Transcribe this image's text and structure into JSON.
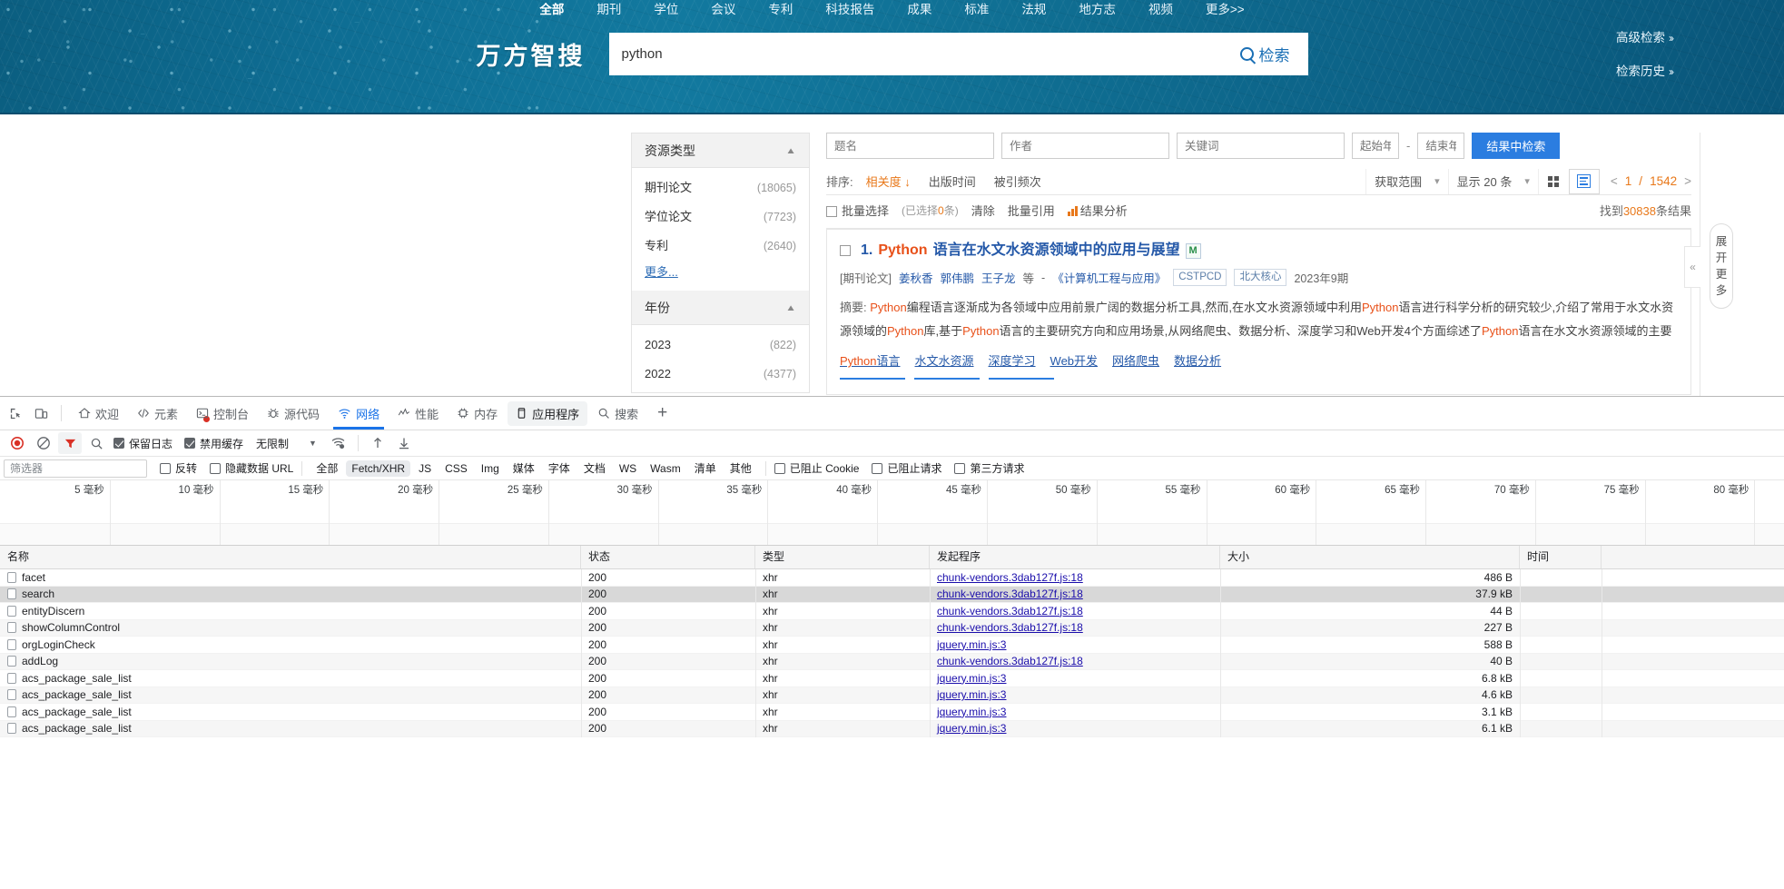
{
  "site": {
    "brand": "万方智搜",
    "topnav": [
      {
        "label": "全部",
        "active": true
      },
      {
        "label": "期刊",
        "active": false
      },
      {
        "label": "学位",
        "active": false
      },
      {
        "label": "会议",
        "active": false
      },
      {
        "label": "专利",
        "active": false
      },
      {
        "label": "科技报告",
        "active": false
      },
      {
        "label": "成果",
        "active": false
      },
      {
        "label": "标准",
        "active": false
      },
      {
        "label": "法规",
        "active": false
      },
      {
        "label": "地方志",
        "active": false
      },
      {
        "label": "视频",
        "active": false
      },
      {
        "label": "更多>>",
        "active": false
      }
    ],
    "search": {
      "value": "python",
      "placeholder": "",
      "button_label": "检索"
    },
    "side_links": [
      {
        "label": "高级检索"
      },
      {
        "label": "检索历史"
      }
    ]
  },
  "facets": [
    {
      "title": "资源类型",
      "items": [
        {
          "label": "期刊论文",
          "count": "(18065)"
        },
        {
          "label": "学位论文",
          "count": "(7723)"
        },
        {
          "label": "专利",
          "count": "(2640)"
        }
      ],
      "more": "更多..."
    },
    {
      "title": "年份",
      "items": [
        {
          "label": "2023",
          "count": "(822)"
        },
        {
          "label": "2022",
          "count": "(4377)"
        }
      ],
      "more": ""
    }
  ],
  "refine": {
    "title_placeholder": "题名",
    "author_placeholder": "作者",
    "keyword_placeholder": "关键词",
    "start_year_placeholder": "起始年",
    "end_year_placeholder": "结束年",
    "dash": "-",
    "button_label": "结果中检索"
  },
  "sortbar": {
    "label": "排序:",
    "options": [
      {
        "label": "相关度",
        "active": true
      },
      {
        "label": "出版时间",
        "active": false
      },
      {
        "label": "被引频次",
        "active": false
      }
    ],
    "scope_label": "获取范围",
    "perpage_label": "显示 20 条",
    "page_current": "1",
    "page_total": "1542",
    "page_sep": "/",
    "prev": "<",
    "next": ">"
  },
  "bulkbar": {
    "select_all": "批量选择",
    "selected_hint_pre": "(已选择",
    "selected_count": "0",
    "selected_hint_post": "条)",
    "clear": "清除",
    "cite": "批量引用",
    "analysis": "结果分析",
    "found_pre": "找到",
    "found_count": "30838",
    "found_post": "条结果"
  },
  "result": {
    "index": "1.",
    "title_hl": "Python",
    "title_rest": "语言在水文水资源领域中的应用与展望",
    "badge": "M",
    "type": "[期刊论文]",
    "authors": [
      "姜秋香",
      "郭伟鹏",
      "王子龙"
    ],
    "authors_etc": "等",
    "journal_sep": "-",
    "journal": "《计算机工程与应用》",
    "tags": [
      "CSTPCD",
      "北大核心"
    ],
    "issue": "2023年9期",
    "abstract_label": "摘要:",
    "abstract": "Python编程语言逐渐成为各领域中应用前景广阔的数据分析工具,然而,在水文水资源领域中利用Python语言进行科学分析的研究较少,介绍了常用于水文水资源领域的Python库,基于Python语言的主要研究方向和应用场景,从网络爬虫、数据分析、深度学习和Web开发4个方面综述了Python语言在水文水资源领域的主要研究内容,归纳了深...",
    "keywords": [
      "Python语言",
      "水文水资源",
      "深度学习",
      "Web开发",
      "网络爬虫",
      "数据分析"
    ]
  },
  "rail": {
    "collapse_icon": "«",
    "expand_label": "展开更多"
  },
  "devtools": {
    "tabs": [
      {
        "label": "欢迎",
        "icon": "home-icon",
        "selected": false,
        "boxed": false
      },
      {
        "label": "元素",
        "icon": "code-icon",
        "selected": false,
        "boxed": false
      },
      {
        "label": "控制台",
        "icon": "console-icon",
        "selected": false,
        "boxed": false,
        "error": true
      },
      {
        "label": "源代码",
        "icon": "bug-icon",
        "selected": false,
        "boxed": false
      },
      {
        "label": "网络",
        "icon": "network-icon",
        "selected": true,
        "boxed": false
      },
      {
        "label": "性能",
        "icon": "performance-icon",
        "selected": false,
        "boxed": false
      },
      {
        "label": "内存",
        "icon": "memory-icon",
        "selected": false,
        "boxed": false
      },
      {
        "label": "应用程序",
        "icon": "application-icon",
        "selected": false,
        "boxed": true
      },
      {
        "label": "搜索",
        "icon": "search-icon",
        "selected": false,
        "boxed": false
      }
    ],
    "add_tab": "+",
    "toolbar": {
      "record_title": "record",
      "clear_title": "clear",
      "filter_title": "filter",
      "search_title": "search",
      "preserve_log": "保留日志",
      "disable_cache": "禁用缓存",
      "throttle": "无限制",
      "throttle_caret": "▼"
    },
    "filterbar": {
      "placeholder": "筛选器",
      "value": "",
      "invert": "反转",
      "hide_data_urls": "隐藏数据 URL",
      "types": [
        {
          "label": "全部",
          "on": false
        },
        {
          "label": "Fetch/XHR",
          "on": true
        },
        {
          "label": "JS",
          "on": false
        },
        {
          "label": "CSS",
          "on": false
        },
        {
          "label": "Img",
          "on": false
        },
        {
          "label": "媒体",
          "on": false
        },
        {
          "label": "字体",
          "on": false
        },
        {
          "label": "文档",
          "on": false
        },
        {
          "label": "WS",
          "on": false
        },
        {
          "label": "Wasm",
          "on": false
        },
        {
          "label": "清单",
          "on": false
        },
        {
          "label": "其他",
          "on": false
        }
      ],
      "blocked_cookies": "已阻止 Cookie",
      "blocked_requests": "已阻止请求",
      "third_party": "第三方请求"
    },
    "overview": {
      "unit": "毫秒",
      "ticks": [
        "5",
        "10",
        "15",
        "20",
        "25",
        "30",
        "35",
        "40",
        "45",
        "50",
        "55",
        "60",
        "65",
        "70",
        "75",
        "80"
      ]
    },
    "columns": [
      "名称",
      "状态",
      "类型",
      "发起程序",
      "大小",
      "时间"
    ],
    "rows": [
      {
        "name": "facet",
        "status": "200",
        "type": "xhr",
        "initiator": "chunk-vendors.3dab127f.js:18",
        "size": "486 B",
        "time": "",
        "selected": false
      },
      {
        "name": "search",
        "status": "200",
        "type": "xhr",
        "initiator": "chunk-vendors.3dab127f.js:18",
        "size": "37.9 kB",
        "time": "",
        "selected": true
      },
      {
        "name": "entityDiscern",
        "status": "200",
        "type": "xhr",
        "initiator": "chunk-vendors.3dab127f.js:18",
        "size": "44 B",
        "time": "",
        "selected": false
      },
      {
        "name": "showColumnControl",
        "status": "200",
        "type": "xhr",
        "initiator": "chunk-vendors.3dab127f.js:18",
        "size": "227 B",
        "time": "",
        "selected": false
      },
      {
        "name": "orgLoginCheck",
        "status": "200",
        "type": "xhr",
        "initiator": "jquery.min.js:3",
        "size": "588 B",
        "time": "",
        "selected": false
      },
      {
        "name": "addLog",
        "status": "200",
        "type": "xhr",
        "initiator": "chunk-vendors.3dab127f.js:18",
        "size": "40 B",
        "time": "",
        "selected": false
      },
      {
        "name": "acs_package_sale_list",
        "status": "200",
        "type": "xhr",
        "initiator": "jquery.min.js:3",
        "size": "6.8 kB",
        "time": "",
        "selected": false
      },
      {
        "name": "acs_package_sale_list",
        "status": "200",
        "type": "xhr",
        "initiator": "jquery.min.js:3",
        "size": "4.6 kB",
        "time": "",
        "selected": false
      },
      {
        "name": "acs_package_sale_list",
        "status": "200",
        "type": "xhr",
        "initiator": "jquery.min.js:3",
        "size": "3.1 kB",
        "time": "",
        "selected": false
      },
      {
        "name": "acs_package_sale_list",
        "status": "200",
        "type": "xhr",
        "initiator": "jquery.min.js:3",
        "size": "6.1 kB",
        "time": "",
        "selected": false
      }
    ]
  },
  "colors": {
    "banner": "#0f6e92",
    "accent_blue": "#2b7de0",
    "accent_orange": "#e8781a",
    "devtools_blue": "#1a73e8",
    "link": "#1a0dab"
  }
}
